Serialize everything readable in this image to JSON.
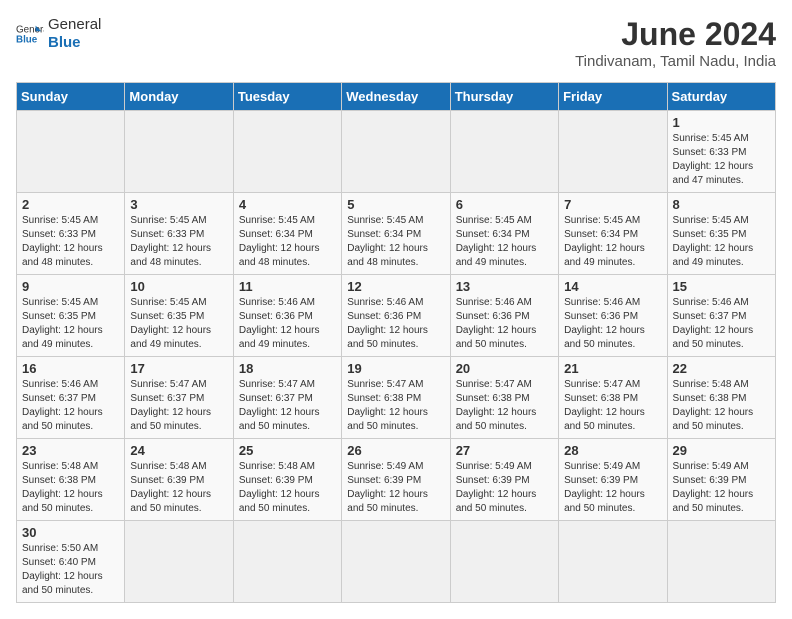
{
  "logo": {
    "general": "General",
    "blue": "Blue"
  },
  "title": "June 2024",
  "subtitle": "Tindivanam, Tamil Nadu, India",
  "days_of_week": [
    "Sunday",
    "Monday",
    "Tuesday",
    "Wednesday",
    "Thursday",
    "Friday",
    "Saturday"
  ],
  "weeks": [
    [
      {
        "day": "",
        "info": ""
      },
      {
        "day": "",
        "info": ""
      },
      {
        "day": "",
        "info": ""
      },
      {
        "day": "",
        "info": ""
      },
      {
        "day": "",
        "info": ""
      },
      {
        "day": "",
        "info": ""
      },
      {
        "day": "1",
        "info": "Sunrise: 5:45 AM\nSunset: 6:33 PM\nDaylight: 12 hours and 47 minutes."
      }
    ],
    [
      {
        "day": "2",
        "info": "Sunrise: 5:45 AM\nSunset: 6:33 PM\nDaylight: 12 hours and 48 minutes."
      },
      {
        "day": "3",
        "info": "Sunrise: 5:45 AM\nSunset: 6:33 PM\nDaylight: 12 hours and 48 minutes."
      },
      {
        "day": "4",
        "info": "Sunrise: 5:45 AM\nSunset: 6:34 PM\nDaylight: 12 hours and 48 minutes."
      },
      {
        "day": "5",
        "info": "Sunrise: 5:45 AM\nSunset: 6:34 PM\nDaylight: 12 hours and 48 minutes."
      },
      {
        "day": "6",
        "info": "Sunrise: 5:45 AM\nSunset: 6:34 PM\nDaylight: 12 hours and 49 minutes."
      },
      {
        "day": "7",
        "info": "Sunrise: 5:45 AM\nSunset: 6:34 PM\nDaylight: 12 hours and 49 minutes."
      },
      {
        "day": "8",
        "info": "Sunrise: 5:45 AM\nSunset: 6:35 PM\nDaylight: 12 hours and 49 minutes."
      }
    ],
    [
      {
        "day": "9",
        "info": "Sunrise: 5:45 AM\nSunset: 6:35 PM\nDaylight: 12 hours and 49 minutes."
      },
      {
        "day": "10",
        "info": "Sunrise: 5:45 AM\nSunset: 6:35 PM\nDaylight: 12 hours and 49 minutes."
      },
      {
        "day": "11",
        "info": "Sunrise: 5:46 AM\nSunset: 6:36 PM\nDaylight: 12 hours and 49 minutes."
      },
      {
        "day": "12",
        "info": "Sunrise: 5:46 AM\nSunset: 6:36 PM\nDaylight: 12 hours and 50 minutes."
      },
      {
        "day": "13",
        "info": "Sunrise: 5:46 AM\nSunset: 6:36 PM\nDaylight: 12 hours and 50 minutes."
      },
      {
        "day": "14",
        "info": "Sunrise: 5:46 AM\nSunset: 6:36 PM\nDaylight: 12 hours and 50 minutes."
      },
      {
        "day": "15",
        "info": "Sunrise: 5:46 AM\nSunset: 6:37 PM\nDaylight: 12 hours and 50 minutes."
      }
    ],
    [
      {
        "day": "16",
        "info": "Sunrise: 5:46 AM\nSunset: 6:37 PM\nDaylight: 12 hours and 50 minutes."
      },
      {
        "day": "17",
        "info": "Sunrise: 5:47 AM\nSunset: 6:37 PM\nDaylight: 12 hours and 50 minutes."
      },
      {
        "day": "18",
        "info": "Sunrise: 5:47 AM\nSunset: 6:37 PM\nDaylight: 12 hours and 50 minutes."
      },
      {
        "day": "19",
        "info": "Sunrise: 5:47 AM\nSunset: 6:38 PM\nDaylight: 12 hours and 50 minutes."
      },
      {
        "day": "20",
        "info": "Sunrise: 5:47 AM\nSunset: 6:38 PM\nDaylight: 12 hours and 50 minutes."
      },
      {
        "day": "21",
        "info": "Sunrise: 5:47 AM\nSunset: 6:38 PM\nDaylight: 12 hours and 50 minutes."
      },
      {
        "day": "22",
        "info": "Sunrise: 5:48 AM\nSunset: 6:38 PM\nDaylight: 12 hours and 50 minutes."
      }
    ],
    [
      {
        "day": "23",
        "info": "Sunrise: 5:48 AM\nSunset: 6:38 PM\nDaylight: 12 hours and 50 minutes."
      },
      {
        "day": "24",
        "info": "Sunrise: 5:48 AM\nSunset: 6:39 PM\nDaylight: 12 hours and 50 minutes."
      },
      {
        "day": "25",
        "info": "Sunrise: 5:48 AM\nSunset: 6:39 PM\nDaylight: 12 hours and 50 minutes."
      },
      {
        "day": "26",
        "info": "Sunrise: 5:49 AM\nSunset: 6:39 PM\nDaylight: 12 hours and 50 minutes."
      },
      {
        "day": "27",
        "info": "Sunrise: 5:49 AM\nSunset: 6:39 PM\nDaylight: 12 hours and 50 minutes."
      },
      {
        "day": "28",
        "info": "Sunrise: 5:49 AM\nSunset: 6:39 PM\nDaylight: 12 hours and 50 minutes."
      },
      {
        "day": "29",
        "info": "Sunrise: 5:49 AM\nSunset: 6:39 PM\nDaylight: 12 hours and 50 minutes."
      }
    ],
    [
      {
        "day": "30",
        "info": "Sunrise: 5:50 AM\nSunset: 6:40 PM\nDaylight: 12 hours and 50 minutes."
      },
      {
        "day": "",
        "info": ""
      },
      {
        "day": "",
        "info": ""
      },
      {
        "day": "",
        "info": ""
      },
      {
        "day": "",
        "info": ""
      },
      {
        "day": "",
        "info": ""
      },
      {
        "day": "",
        "info": ""
      }
    ]
  ]
}
